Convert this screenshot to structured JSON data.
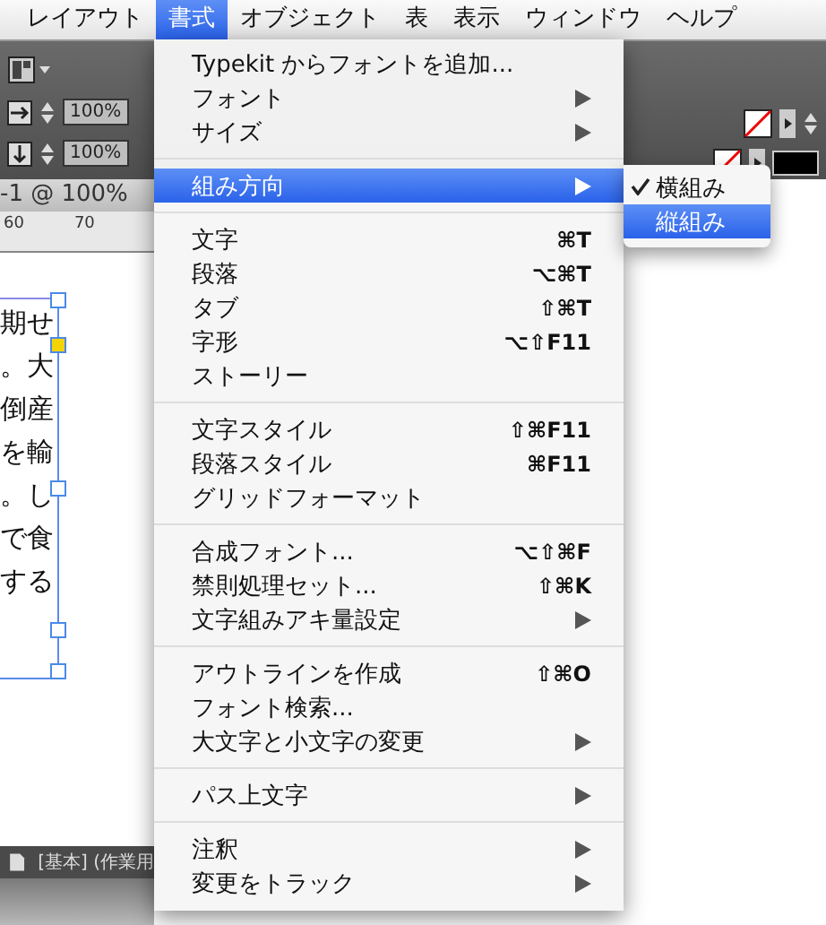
{
  "menubar": [
    {
      "label": "レイアウト",
      "selected": false
    },
    {
      "label": "書式",
      "selected": true
    },
    {
      "label": "オブジェクト",
      "selected": false
    },
    {
      "label": "表",
      "selected": false
    },
    {
      "label": "表示",
      "selected": false
    },
    {
      "label": "ウィンドウ",
      "selected": false
    },
    {
      "label": "ヘルプ",
      "selected": false
    }
  ],
  "toolbar": {
    "fields": [
      "100%",
      "100%"
    ]
  },
  "document": {
    "tab": "-1 @ 100%",
    "ruler": [
      "60",
      "70"
    ],
    "lines": [
      "期せ",
      "。大",
      "倒産",
      "を輸",
      "。し",
      "で食",
      "する"
    ]
  },
  "status_bar": {
    "text": "[基本] (作業用"
  },
  "menu": {
    "sections": [
      [
        {
          "label": "Typekit からフォントを追加...",
          "submenu": false,
          "selected": false
        },
        {
          "label": "フォント",
          "submenu": true,
          "selected": false
        },
        {
          "label": "サイズ",
          "submenu": true,
          "selected": false
        }
      ],
      [
        {
          "label": "組み方向",
          "submenu": true,
          "selected": true
        }
      ],
      [
        {
          "label": "文字",
          "shortcut": "⌘T",
          "submenu": false,
          "selected": false
        },
        {
          "label": "段落",
          "shortcut": "⌥⌘T",
          "submenu": false,
          "selected": false
        },
        {
          "label": "タブ",
          "shortcut": "⇧⌘T",
          "submenu": false,
          "selected": false
        },
        {
          "label": "字形",
          "shortcut": "⌥⇧F11",
          "submenu": false,
          "selected": false
        },
        {
          "label": "ストーリー",
          "submenu": false,
          "selected": false
        }
      ],
      [
        {
          "label": "文字スタイル",
          "shortcut": "⇧⌘F11",
          "submenu": false,
          "selected": false
        },
        {
          "label": "段落スタイル",
          "shortcut": "⌘F11",
          "submenu": false,
          "selected": false
        },
        {
          "label": "グリッドフォーマット",
          "submenu": false,
          "selected": false
        }
      ],
      [
        {
          "label": "合成フォント...",
          "shortcut": "⌥⇧⌘F",
          "submenu": false,
          "selected": false
        },
        {
          "label": "禁則処理セット...",
          "shortcut": "⇧⌘K",
          "submenu": false,
          "selected": false
        },
        {
          "label": "文字組みアキ量設定",
          "submenu": true,
          "selected": false
        }
      ],
      [
        {
          "label": "アウトラインを作成",
          "shortcut": "⇧⌘O",
          "submenu": false,
          "selected": false
        },
        {
          "label": "フォント検索...",
          "submenu": false,
          "selected": false
        },
        {
          "label": "大文字と小文字の変更",
          "submenu": true,
          "selected": false
        }
      ],
      [
        {
          "label": "パス上文字",
          "submenu": true,
          "selected": false
        }
      ],
      [
        {
          "label": "注釈",
          "submenu": true,
          "selected": false
        },
        {
          "label": "変更をトラック",
          "submenu": true,
          "selected": false
        }
      ]
    ]
  },
  "submenu": [
    {
      "label": "横組み",
      "checked": true,
      "selected": false
    },
    {
      "label": "縦組み",
      "checked": false,
      "selected": true
    }
  ]
}
